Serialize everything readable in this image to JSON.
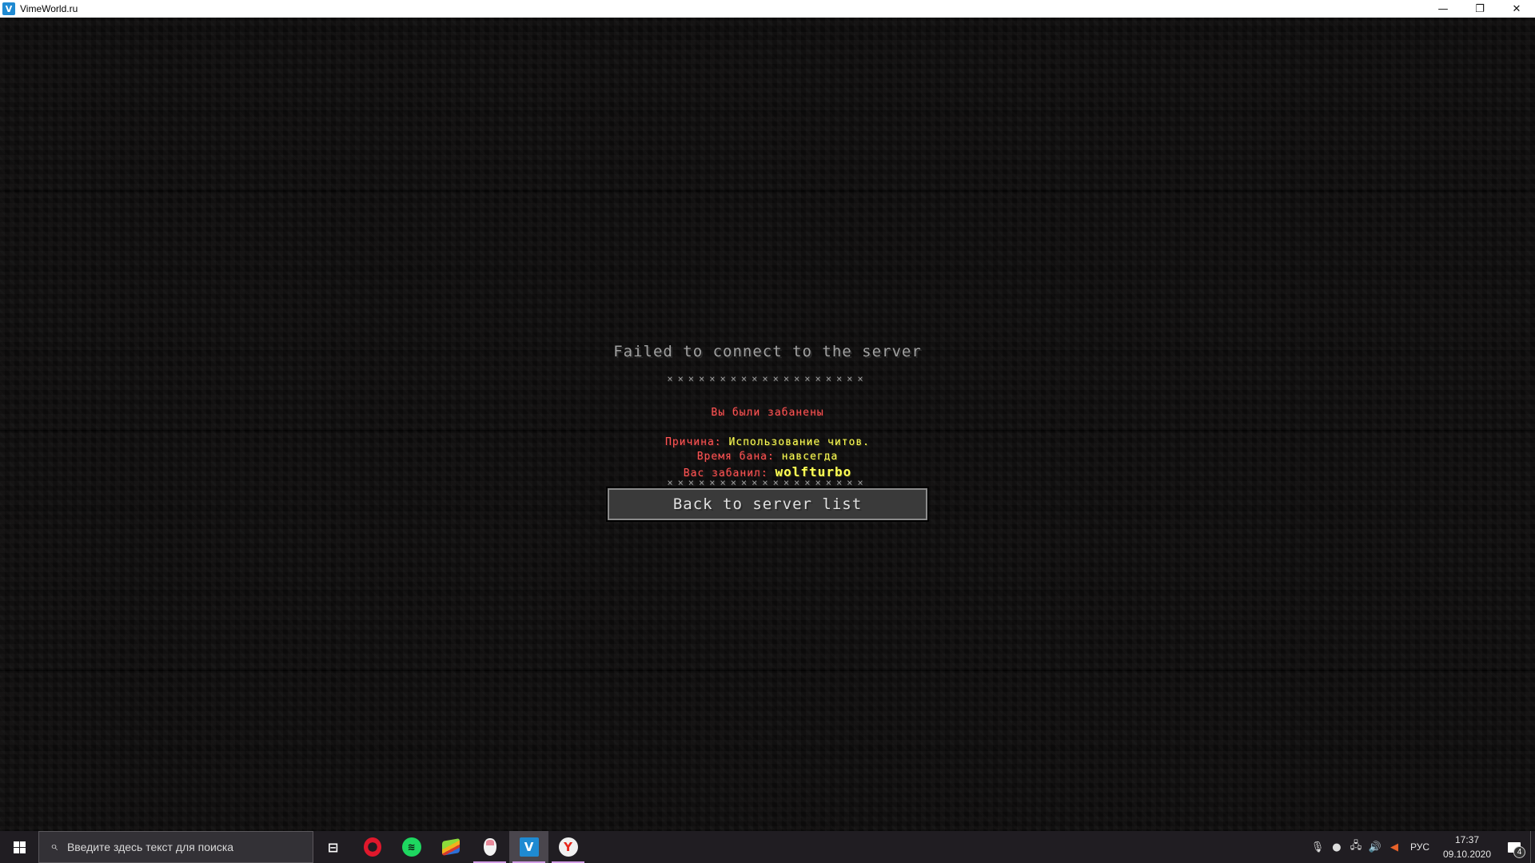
{
  "window": {
    "title": "VimeWorld.ru",
    "app_icon_glyph": "V",
    "controls": {
      "minimize": "—",
      "restore": "❐",
      "close": "✕"
    }
  },
  "screen": {
    "heading": "Failed to connect to the server",
    "separator": "×××××××××××××××××××",
    "banned_message": "Вы были забанены",
    "reason": {
      "label": "Причина:",
      "value": "Использование читов."
    },
    "duration": {
      "label": "Время бана:",
      "value": "навсегда"
    },
    "banned_by": {
      "label": "Вас забанил:",
      "value": "wolfturbo"
    },
    "back_button": "Back to server list"
  },
  "colors": {
    "heading": "#a0a0a0",
    "label_red": "#ff5555",
    "value_yellow": "#ffff55",
    "taskbar": "#201d22",
    "indicator": "#d29de6"
  },
  "taskbar": {
    "search_placeholder": "Введите здесь текст для поиска",
    "apps": [
      {
        "name": "task-view",
        "icon": "task-view-icon",
        "glyph": "⊟",
        "running": false,
        "active": false
      },
      {
        "name": "opera",
        "icon": "opera-icon",
        "glyph": "",
        "running": false,
        "active": false
      },
      {
        "name": "spotify",
        "icon": "spotify-icon",
        "glyph": "≋",
        "running": false,
        "active": false
      },
      {
        "name": "bluestacks",
        "icon": "bluestacks-icon",
        "glyph": "",
        "running": false,
        "active": false
      },
      {
        "name": "mouse-app",
        "icon": "mouse-icon",
        "glyph": "",
        "running": true,
        "active": false
      },
      {
        "name": "vimeworld",
        "icon": "vimeworld-icon",
        "glyph": "V",
        "running": true,
        "active": true
      },
      {
        "name": "yandex-browser",
        "icon": "yandex-icon",
        "glyph": "Y",
        "running": true,
        "active": false
      }
    ],
    "tray": {
      "mic_muted_glyph": "🎙",
      "mouse_glyph": "●",
      "network_glyph": "🖧",
      "volume_glyph": "🔊",
      "speaker_glyph": "◀",
      "language": "РУС",
      "time": "17:37",
      "date": "09.10.2020",
      "notification_count": "4"
    }
  }
}
